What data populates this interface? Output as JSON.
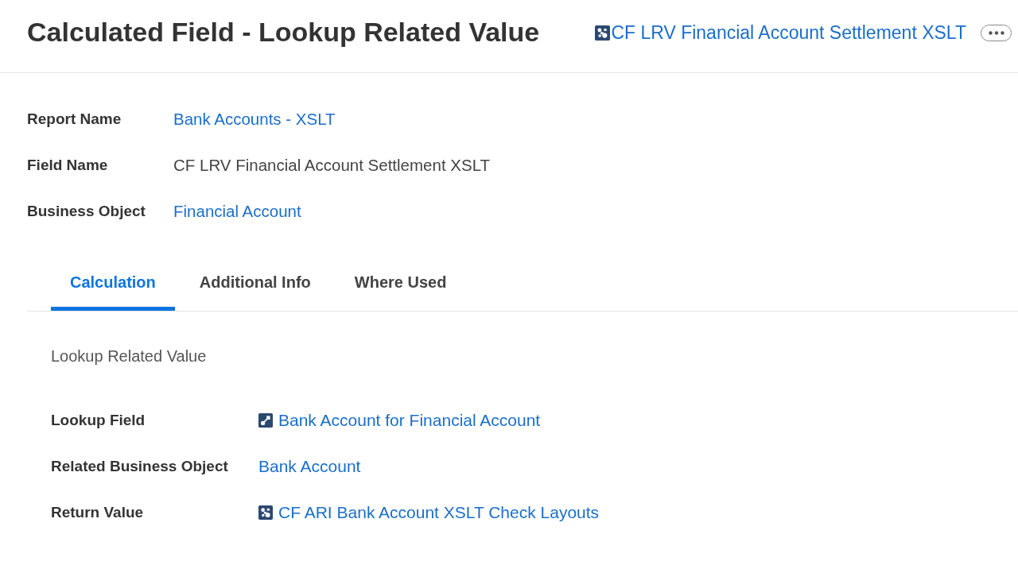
{
  "header": {
    "title": "Calculated Field - Lookup Related Value",
    "related_field": {
      "text": "CF LRV Financial Account Settlement XSLT",
      "kind": "calculated"
    }
  },
  "details": [
    {
      "label": "Report Name",
      "value": "Bank Accounts - XSLT",
      "kind": "link"
    },
    {
      "label": "Field Name",
      "value": "CF LRV Financial Account Settlement XSLT",
      "kind": "text"
    },
    {
      "label": "Business Object",
      "value": "Financial Account",
      "kind": "link"
    }
  ],
  "tabs": [
    {
      "label": "Calculation",
      "selected": true
    },
    {
      "label": "Additional Info",
      "selected": false
    },
    {
      "label": "Where Used",
      "selected": false
    }
  ],
  "calculation": {
    "function": "Lookup Related Value",
    "rows": [
      {
        "label": "Lookup Field",
        "value": "Bank Account for Financial Account",
        "kind": "relation"
      },
      {
        "label": "Related Business Object",
        "value": "Bank Account",
        "kind": "link"
      },
      {
        "label": "Return Value",
        "value": "CF ARI Bank Account XSLT Check Layouts",
        "kind": "calculated"
      }
    ]
  }
}
